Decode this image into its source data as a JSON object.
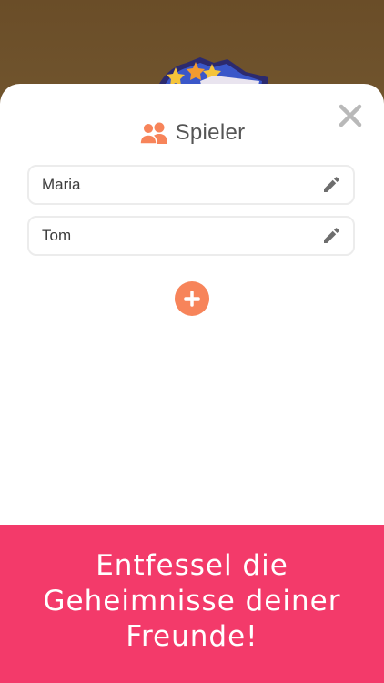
{
  "colors": {
    "background": "#6b4f2a",
    "sheet": "#ffffff",
    "accent": "#f7845a",
    "banner": "#f33a6a",
    "close_icon": "#b9b9b9"
  },
  "dialog": {
    "title": "Spieler",
    "title_icon": "players-icon",
    "close_icon": "close-icon"
  },
  "players": [
    {
      "name": "Maria",
      "edit_icon": "pencil-icon"
    },
    {
      "name": "Tom",
      "edit_icon": "pencil-icon"
    }
  ],
  "add_button_icon": "plus-icon",
  "banner": {
    "text": "Entfessel die Geheimnisse deiner Freunde!"
  }
}
